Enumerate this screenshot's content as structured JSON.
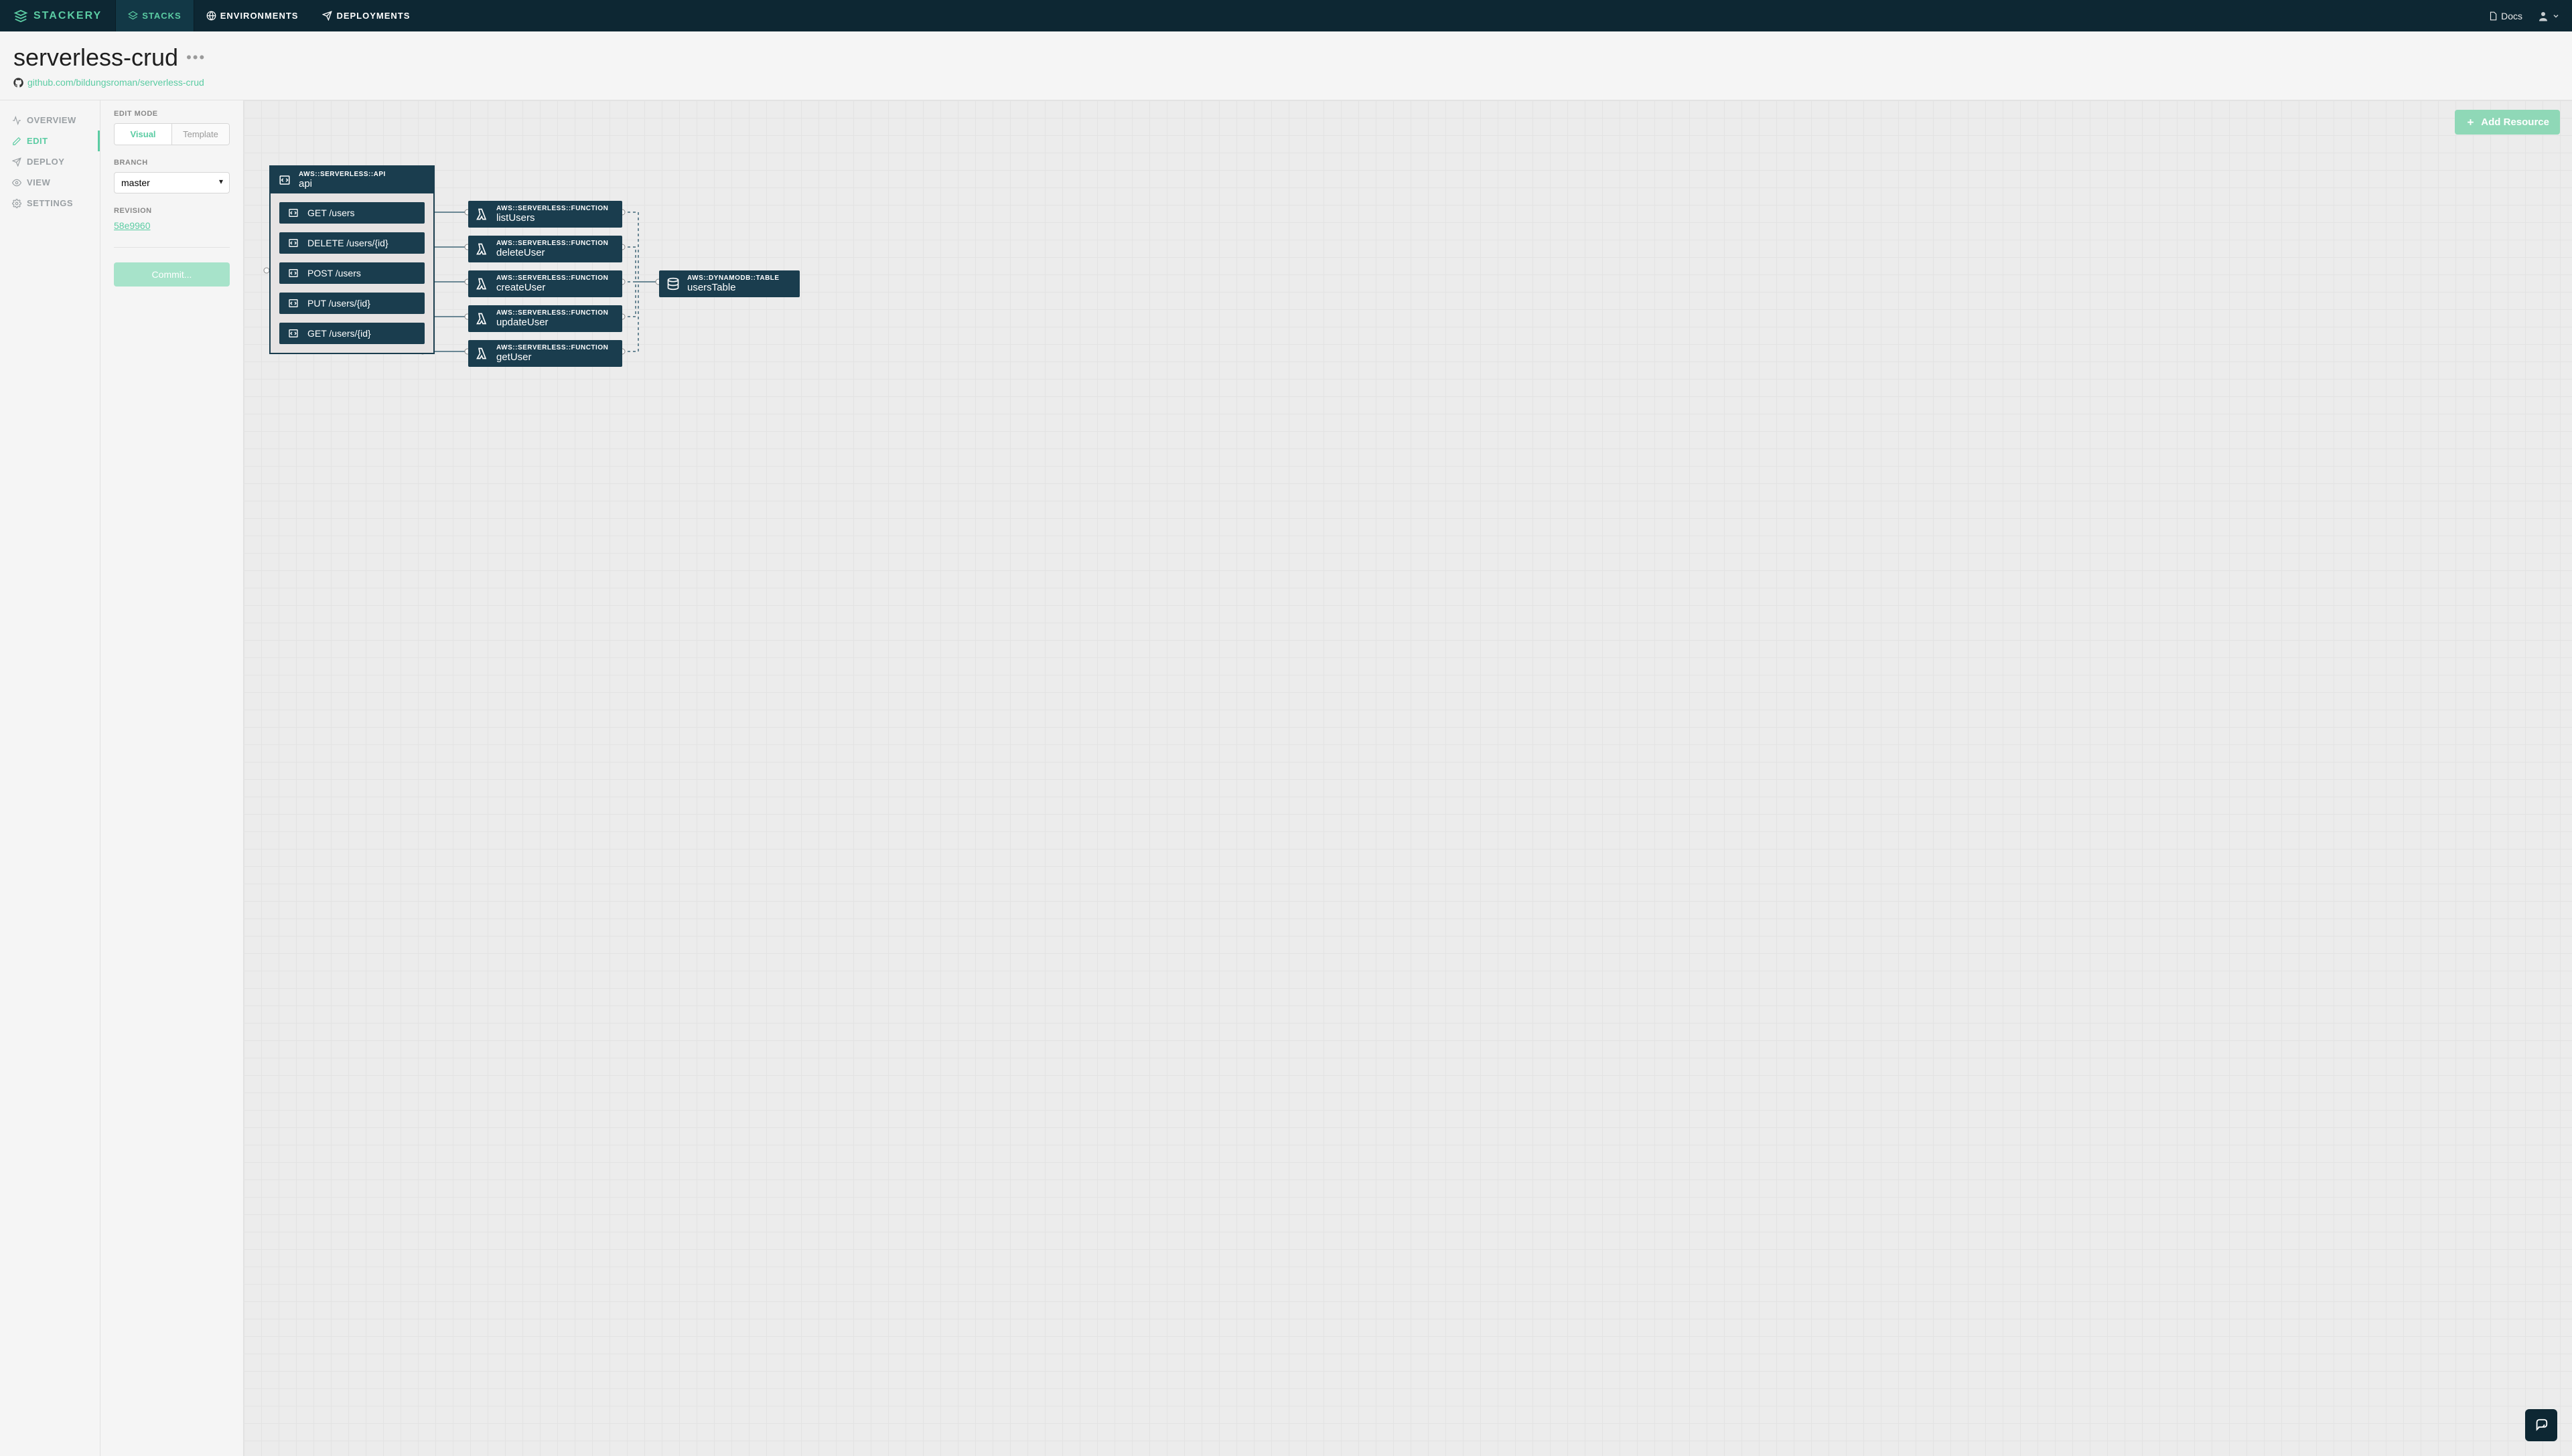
{
  "brand": "STACKERY",
  "topnav": {
    "items": [
      {
        "label": "STACKS",
        "icon": "layers-icon",
        "active": true
      },
      {
        "label": "ENVIRONMENTS",
        "icon": "globe-icon",
        "active": false
      },
      {
        "label": "DEPLOYMENTS",
        "icon": "send-icon",
        "active": false
      }
    ],
    "docs_label": "Docs"
  },
  "stack": {
    "name": "serverless-crud",
    "repo_url": "github.com/bildungsroman/serverless-crud"
  },
  "side1": {
    "items": [
      {
        "label": "OVERVIEW",
        "icon": "activity-icon",
        "active": false
      },
      {
        "label": "EDIT",
        "icon": "pencil-icon",
        "active": true
      },
      {
        "label": "DEPLOY",
        "icon": "send-icon",
        "active": false
      },
      {
        "label": "VIEW",
        "icon": "eye-icon",
        "active": false
      },
      {
        "label": "SETTINGS",
        "icon": "gear-icon",
        "active": false
      }
    ]
  },
  "side2": {
    "edit_mode_label": "EDIT MODE",
    "edit_mode_visual": "Visual",
    "edit_mode_template": "Template",
    "branch_label": "BRANCH",
    "branch_value": "master",
    "revision_label": "REVISION",
    "revision_value": "58e9960",
    "commit_label": "Commit..."
  },
  "canvas": {
    "add_resource_label": "Add Resource"
  },
  "diagram": {
    "api": {
      "type": "AWS::SERVERLESS::API",
      "name": "api",
      "routes": [
        {
          "label": "GET /users"
        },
        {
          "label": "DELETE /users/{id}"
        },
        {
          "label": "POST /users"
        },
        {
          "label": "PUT /users/{id}"
        },
        {
          "label": "GET /users/{id}"
        }
      ]
    },
    "functions": [
      {
        "type": "AWS::SERVERLESS::FUNCTION",
        "name": "listUsers"
      },
      {
        "type": "AWS::SERVERLESS::FUNCTION",
        "name": "deleteUser"
      },
      {
        "type": "AWS::SERVERLESS::FUNCTION",
        "name": "createUser"
      },
      {
        "type": "AWS::SERVERLESS::FUNCTION",
        "name": "updateUser"
      },
      {
        "type": "AWS::SERVERLESS::FUNCTION",
        "name": "getUser"
      }
    ],
    "table": {
      "type": "AWS::DYNAMODB::TABLE",
      "name": "usersTable"
    }
  }
}
